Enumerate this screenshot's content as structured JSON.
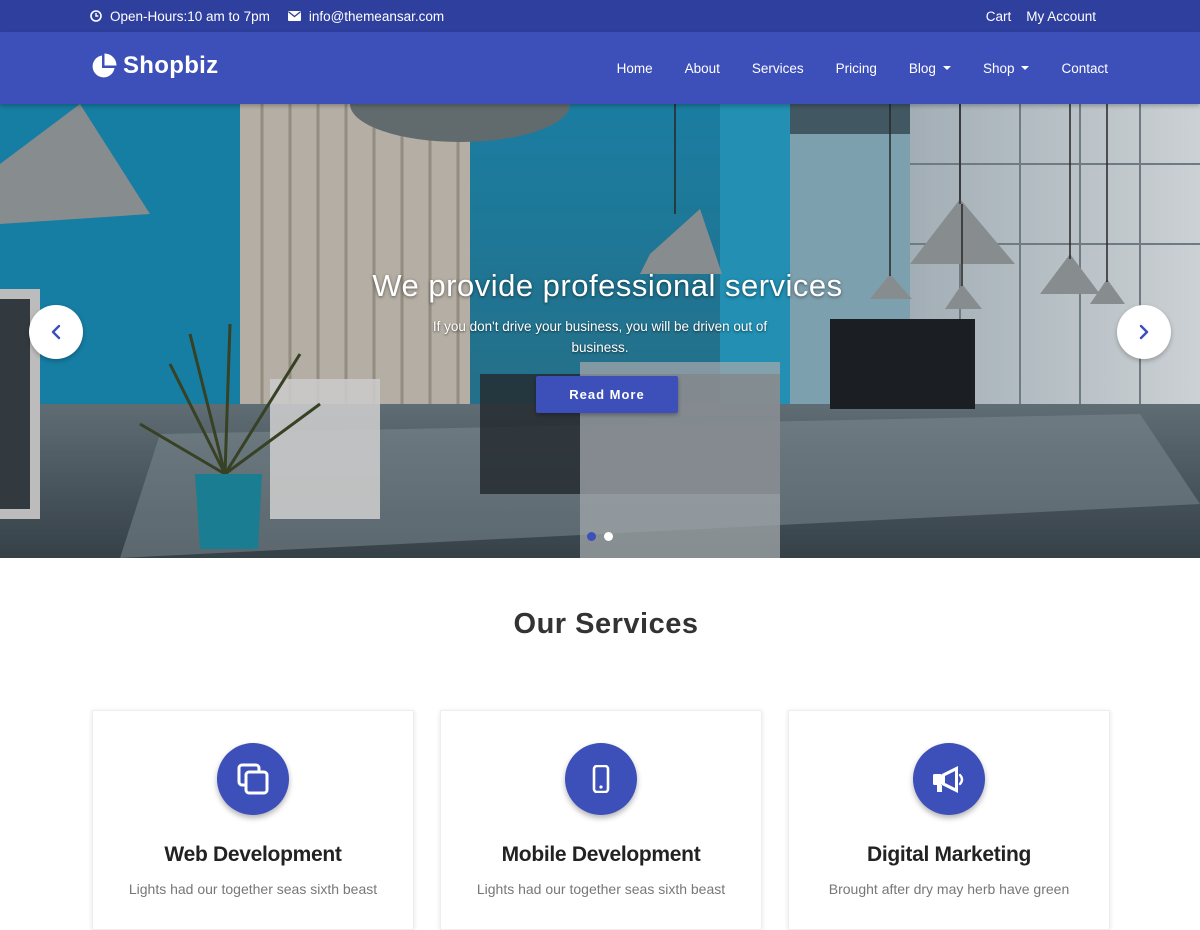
{
  "topbar": {
    "hours": "Open-Hours:10 am to 7pm",
    "email": "info@themeansar.com",
    "cart": "Cart",
    "account": "My Account"
  },
  "header": {
    "logo_text": "Shopbiz",
    "nav": [
      "Home",
      "About",
      "Services",
      "Pricing",
      "Blog",
      "Shop",
      "Contact"
    ]
  },
  "hero": {
    "title": "We provide professional services",
    "subtitle": "If you don't drive your business, you will be driven out of business.",
    "button": "Read More",
    "slides": 2,
    "active_slide": 1
  },
  "services": {
    "title": "Our Services",
    "cards": [
      {
        "icon": "copy-icon",
        "title": "Web Development",
        "text": "Lights had our together seas sixth beast"
      },
      {
        "icon": "mobile-icon",
        "title": "Mobile Development",
        "text": "Lights had our together seas sixth beast"
      },
      {
        "icon": "bullhorn-icon",
        "title": "Digital Marketing",
        "text": "Brought after dry may herb have green"
      }
    ]
  },
  "colors": {
    "topbar": "#2e3f9e",
    "header": "#3d4fb8",
    "accent": "#3d4fb8"
  }
}
